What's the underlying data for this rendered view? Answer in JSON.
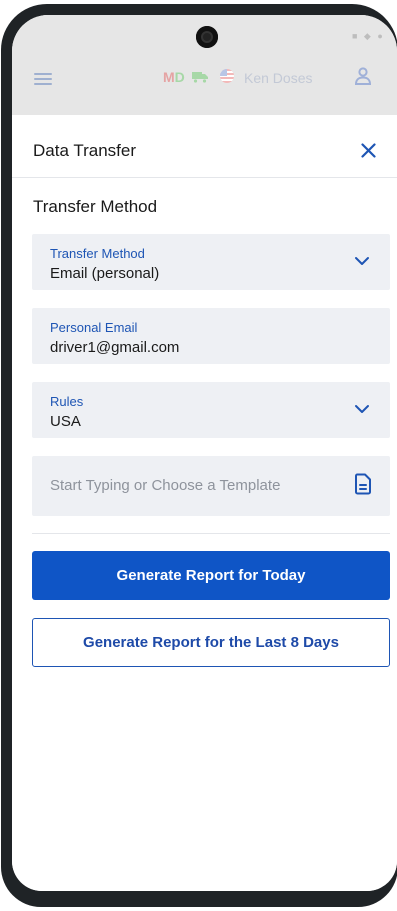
{
  "header": {
    "status_icons": "■ ◆ ●",
    "state_m": "M",
    "state_d": "D",
    "user_name": "Ken Doses"
  },
  "sheet": {
    "title": "Data Transfer",
    "section_title": "Transfer Method"
  },
  "fields": {
    "transfer_method": {
      "label": "Transfer Method",
      "value": "Email (personal)"
    },
    "personal_email": {
      "label": "Personal Email",
      "value": "driver1@gmail.com"
    },
    "rules": {
      "label": "Rules",
      "value": "USA"
    },
    "template": {
      "placeholder": "Start Typing or Choose a Template"
    }
  },
  "buttons": {
    "today": "Generate Report for Today",
    "last_8_days": "Generate Report for the Last 8 Days"
  },
  "colors": {
    "primary": "#0f55c6",
    "label_blue": "#1e55b4",
    "field_bg": "#eef0f4"
  },
  "icons": {
    "menu": "hamburger-menu-icon",
    "close": "close-icon",
    "dropdown": "chevron-down-icon",
    "template": "document-icon",
    "user": "user-icon",
    "truck": "truck-icon",
    "flag": "us-flag-icon"
  }
}
